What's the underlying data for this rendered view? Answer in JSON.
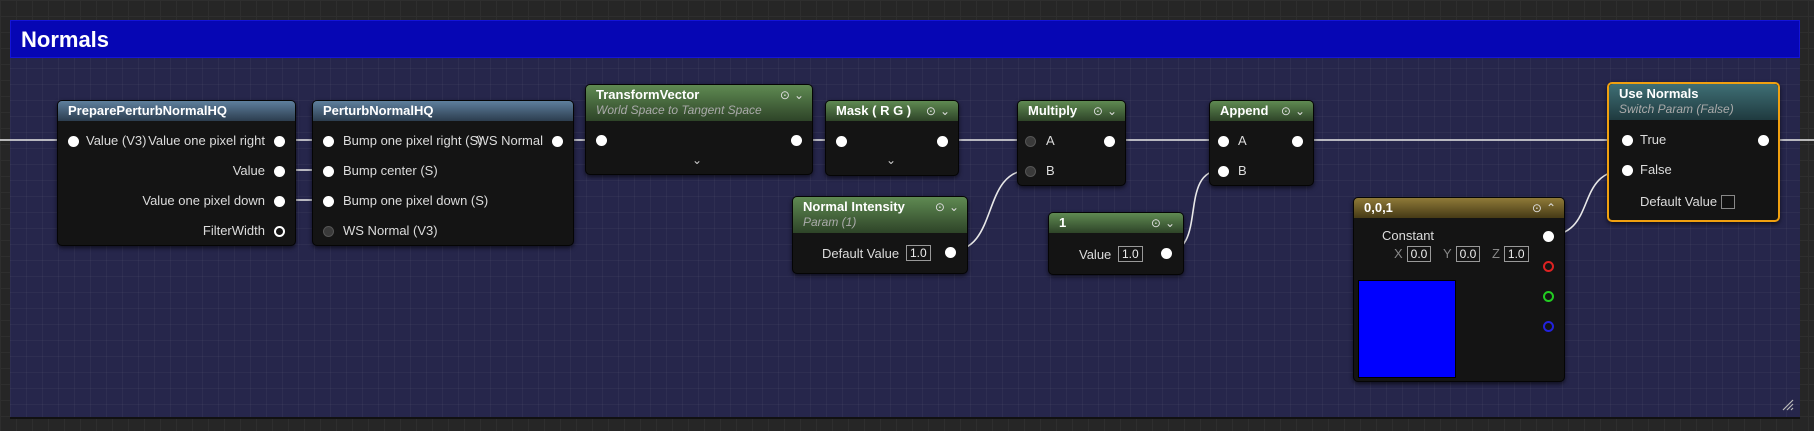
{
  "comment": {
    "title": "Normals",
    "color": "#0606b4"
  },
  "nodes": {
    "prepare": {
      "title": "PreparePerturbNormalHQ",
      "input": "Value (V3)",
      "outputs": [
        "Value one pixel right",
        "Value",
        "Value one pixel down",
        "FilterWidth"
      ]
    },
    "perturb": {
      "title": "PerturbNormalHQ",
      "inputs": [
        "Bump one pixel right (S)",
        "Bump center (S)",
        "Bump one pixel down (S)",
        "WS Normal (V3)"
      ],
      "output": "WS Normal"
    },
    "transform": {
      "title": "TransformVector",
      "subtitle": "World Space to Tangent Space"
    },
    "mask": {
      "title": "Mask ( R G )"
    },
    "multiply": {
      "title": "Multiply",
      "inputs": [
        "A",
        "B"
      ]
    },
    "append": {
      "title": "Append",
      "inputs": [
        "A",
        "B"
      ]
    },
    "normal_intensity": {
      "title": "Normal Intensity",
      "subtitle": "Param (1)",
      "field_label": "Default Value",
      "value": "1.0"
    },
    "constant1": {
      "title": "1",
      "field_label": "Value",
      "value": "1.0"
    },
    "constant3": {
      "title": "0,0,1",
      "output": "Constant",
      "x_label": "X",
      "x": "0.0",
      "y_label": "Y",
      "y": "0.0",
      "z_label": "Z",
      "z": "1.0",
      "color": "#0000ff"
    },
    "use_normals": {
      "title": "Use Normals",
      "subtitle": "Switch Param (False)",
      "inputs": [
        "True",
        "False"
      ],
      "default_label": "Default Value",
      "default_checked": false
    }
  },
  "colors": {
    "selection": "#f0a010",
    "wire": "#e8e8e8"
  }
}
